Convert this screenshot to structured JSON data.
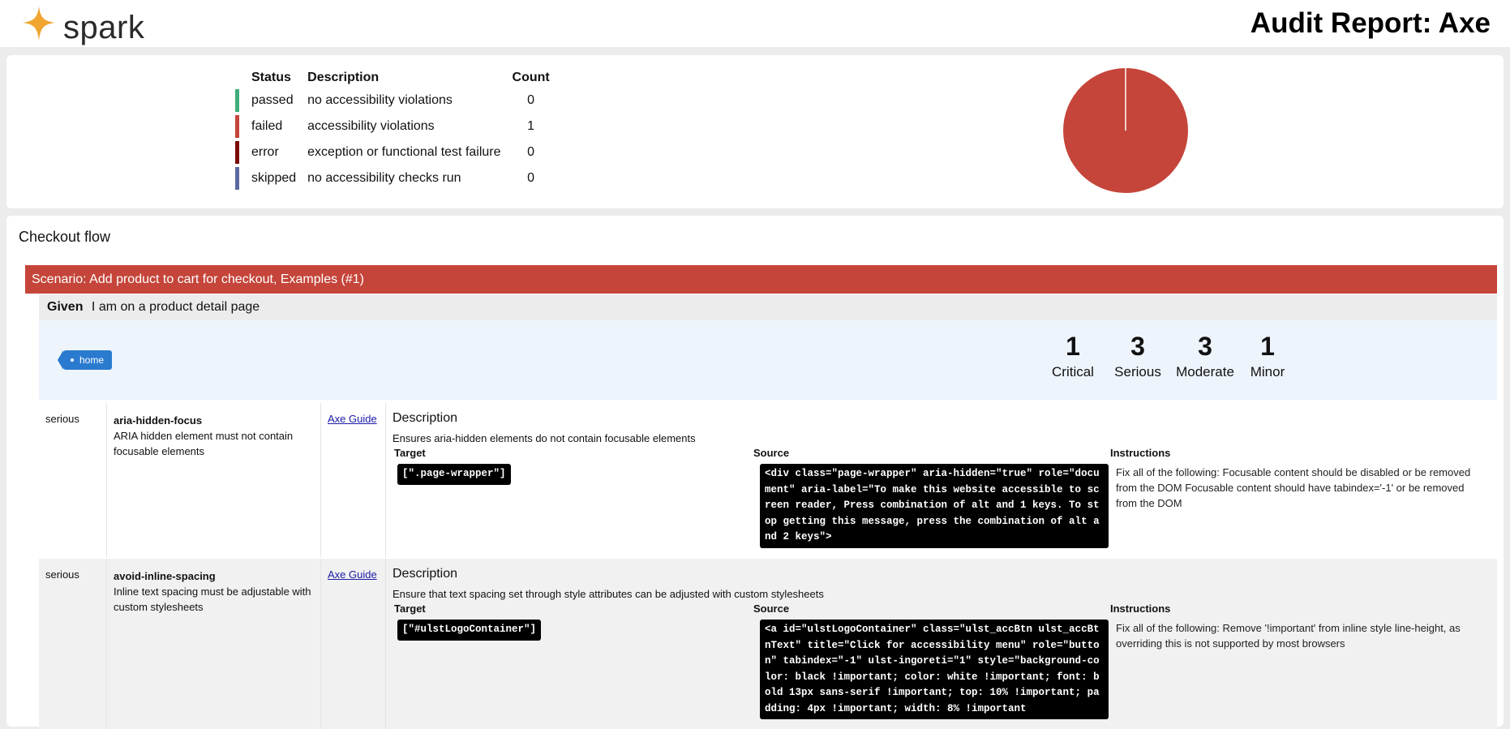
{
  "header": {
    "logo_text": "spark",
    "title": "Audit Report: Axe",
    "brand_color": "#f0a531"
  },
  "summary": {
    "columns": [
      "Status",
      "Description",
      "Count"
    ],
    "rows": [
      {
        "status": "passed",
        "description": "no accessibility violations",
        "count": "0",
        "color": "#3fae7a"
      },
      {
        "status": "failed",
        "description": "accessibility violations",
        "count": "1",
        "color": "#c5453a"
      },
      {
        "status": "error",
        "description": "exception or functional test failure",
        "count": "0",
        "color": "#7a0a0a"
      },
      {
        "status": "skipped",
        "description": "no accessibility checks run",
        "count": "0",
        "color": "#5b6aa0"
      }
    ]
  },
  "chart_data": {
    "type": "pie",
    "categories": [
      "passed",
      "failed",
      "error",
      "skipped"
    ],
    "values": [
      0,
      1,
      0,
      0
    ],
    "colors": [
      "#3fae7a",
      "#c5453a",
      "#7a0a0a",
      "#5b6aa0"
    ]
  },
  "feature": {
    "title": "Checkout flow",
    "scenario": "Scenario: Add product to cart for checkout, Examples (#1)",
    "step_keyword": "Given",
    "step_text": "I am on a product detail page",
    "tag": "home",
    "impacts": [
      {
        "count": "1",
        "label": "Critical"
      },
      {
        "count": "3",
        "label": "Serious"
      },
      {
        "count": "3",
        "label": "Moderate"
      },
      {
        "count": "1",
        "label": "Minor"
      }
    ]
  },
  "violations": [
    {
      "impact": "serious",
      "rule": "aria-hidden-focus",
      "rule_desc": "ARIA hidden element must not contain focusable elements",
      "guide": "Axe Guide",
      "desc_title": "Description",
      "desc": "Ensures aria-hidden elements do not contain focusable elements",
      "target_label": "Target",
      "source_label": "Source",
      "instructions_label": "Instructions",
      "target": "[\".page-wrapper\"]",
      "source": "<div class=\"page-wrapper\" aria-hidden=\"true\" role=\"document\" aria-label=\"To make this website accessible to screen reader, Press combination of alt and 1 keys. To stop getting this message, press the combination of alt and 2 keys\">",
      "instructions": "Fix all of the following: Focusable content should be disabled or be removed from the DOM Focusable content should have tabindex='-1' or be removed from the DOM"
    },
    {
      "impact": "serious",
      "rule": "avoid-inline-spacing",
      "rule_desc": "Inline text spacing must be adjustable with custom stylesheets",
      "guide": "Axe Guide",
      "desc_title": "Description",
      "desc": "Ensure that text spacing set through style attributes can be adjusted with custom stylesheets",
      "target_label": "Target",
      "source_label": "Source",
      "instructions_label": "Instructions",
      "target": "[\"#ulstLogoContainer\"]",
      "source": "<a id=\"ulstLogoContainer\" class=\"ulst_accBtn ulst_accBtnText\" title=\"Click for accessibility menu\" role=\"button\" tabindex=\"-1\" ulst-ingoreti=\"1\" style=\"background-color: black !important; color: white !important; font: bold 13px sans-serif !important; top: 10% !important; padding: 4px !important; width: 8% !important",
      "instructions": "Fix all of the following: Remove '!important' from inline style line-height, as overriding this is not supported by most browsers"
    }
  ]
}
